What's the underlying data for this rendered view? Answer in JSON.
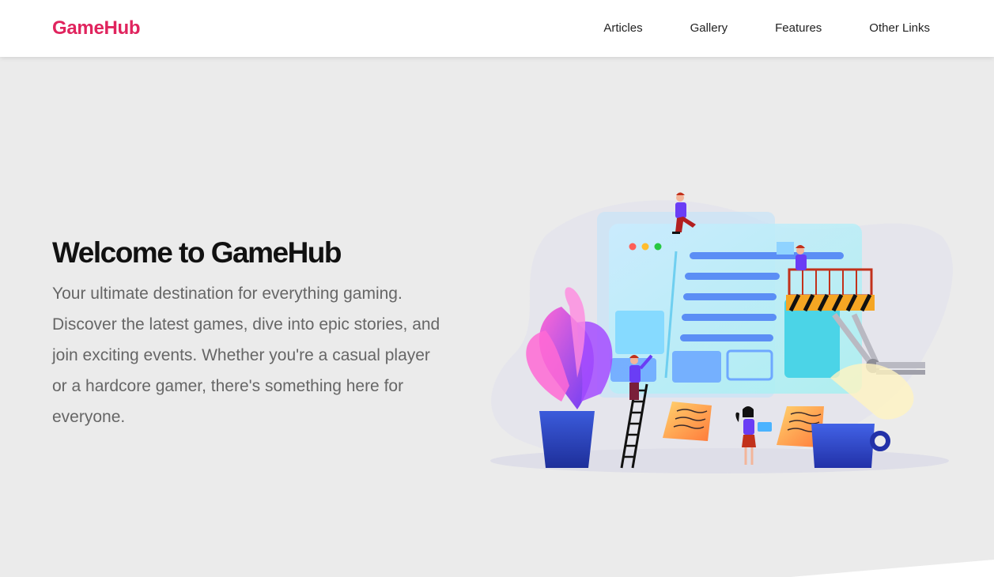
{
  "navbar": {
    "brand": "GameHub",
    "links": [
      "Articles",
      "Gallery",
      "Features",
      "Other Links"
    ]
  },
  "hero": {
    "title": "Welcome to GameHub",
    "description": "Your ultimate destination for everything gaming. Discover the latest games, dive into epic stories, and join exciting events. Whether you're a casual player or a hardcore gamer, there's something here for everyone."
  },
  "colors": {
    "brand": "#e0245e",
    "background": "#ebebeb",
    "title": "#111111",
    "text": "#666666"
  },
  "illustration": {
    "icons": [
      "potted-plant-icon",
      "browser-window-icon",
      "ladder-icon",
      "scissor-lift-icon",
      "sticky-note-icon",
      "coffee-mug-icon",
      "person-icon"
    ]
  }
}
